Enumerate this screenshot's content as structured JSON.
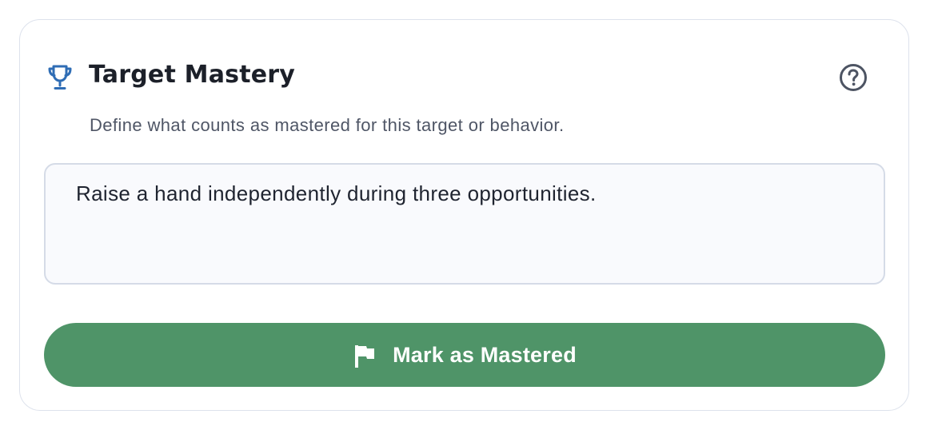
{
  "card": {
    "title": "Target Mastery",
    "subtitle": "Define what counts as mastered for this target or behavior.",
    "icon": "trophy-icon",
    "help_icon": "help-circle-icon"
  },
  "criteria": {
    "value": "Raise a hand independently during three opportunities."
  },
  "action": {
    "label": "Mark as Mastered",
    "icon": "flag-icon"
  },
  "colors": {
    "accent": "#2f6db5",
    "button": "#4f9468",
    "border": "#dde2ec"
  }
}
